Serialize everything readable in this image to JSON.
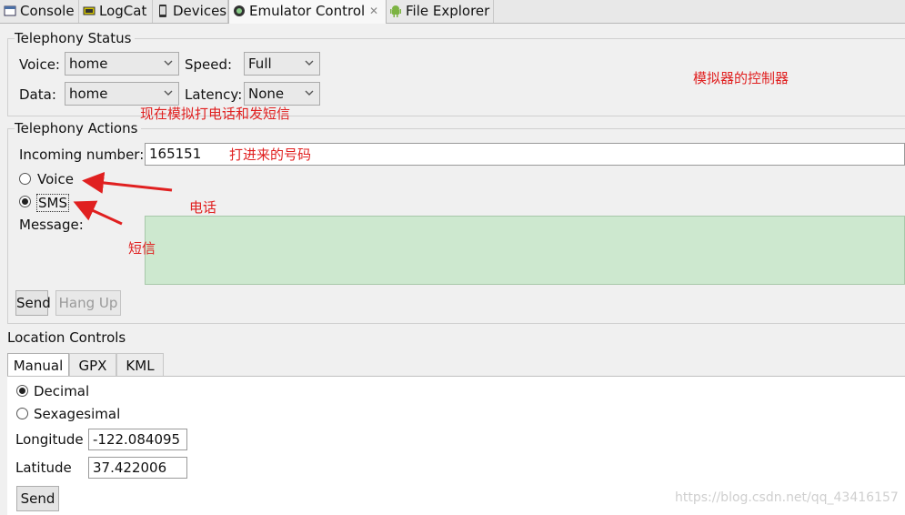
{
  "tabs": [
    {
      "label": "Console",
      "icon": "console-icon"
    },
    {
      "label": "LogCat",
      "icon": "logcat-icon"
    },
    {
      "label": "Devices",
      "icon": "device-icon"
    },
    {
      "label": "Emulator Control",
      "icon": "emulator-icon",
      "active": true
    },
    {
      "label": "File Explorer",
      "icon": "android-icon"
    }
  ],
  "telephony_status": {
    "title": "Telephony Status",
    "voice_label": "Voice:",
    "voice_value": "home",
    "speed_label": "Speed:",
    "speed_value": "Full",
    "data_label": "Data:",
    "data_value": "home",
    "latency_label": "Latency:",
    "latency_value": "None"
  },
  "telephony_actions": {
    "title": "Telephony Actions",
    "incoming_label": "Incoming number:",
    "incoming_value": "165151",
    "voice_option": "Voice",
    "sms_option": "SMS",
    "selected": "SMS",
    "message_label": "Message:",
    "message_value": "",
    "send_label": "Send",
    "hangup_label": "Hang Up"
  },
  "location_controls": {
    "title": "Location Controls",
    "tabs": [
      "Manual",
      "GPX",
      "KML"
    ],
    "active_tab": "Manual",
    "decimal_option": "Decimal",
    "sexagesimal_option": "Sexagesimal",
    "selected_format": "Decimal",
    "longitude_label": "Longitude",
    "longitude_value": "-122.084095",
    "latitude_label": "Latitude",
    "latitude_value": "37.422006",
    "send_label": "Send"
  },
  "annotations": {
    "emulator_controller": "模拟器的控制器",
    "simulate_call_sms": "现在模拟打电话和发短信",
    "incoming_number": "打进来的号码",
    "phone_call": "电话",
    "sms": "短信"
  },
  "watermark": "https://blog.csdn.net/qq_43416157",
  "colors": {
    "annotation_red": "#e02020",
    "message_bg": "#cde8cf"
  }
}
